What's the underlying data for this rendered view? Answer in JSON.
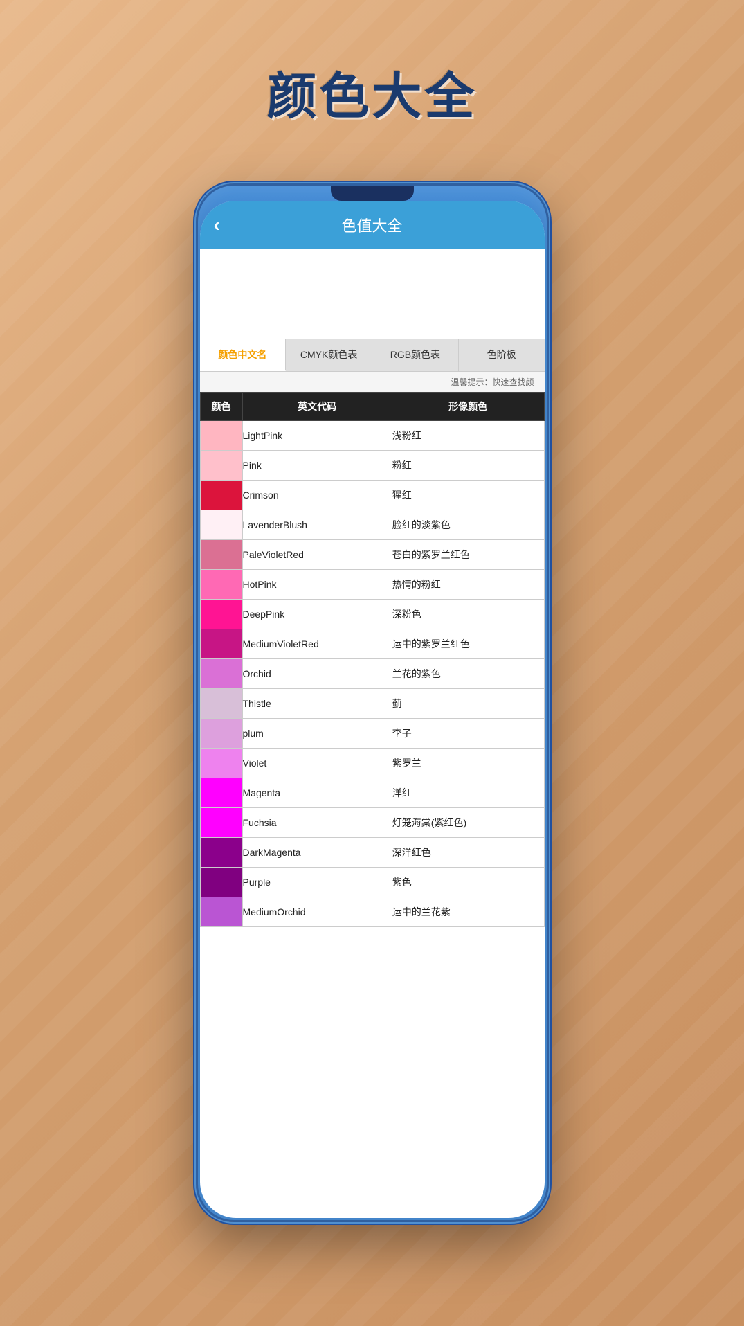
{
  "background": {
    "page_title": "颜色大全"
  },
  "header": {
    "back_label": "‹",
    "title": "色值大全"
  },
  "tabs": [
    {
      "id": "chinese-name",
      "label": "颜色中文名",
      "active": true
    },
    {
      "id": "cmyk",
      "label": "CMYK颜色表",
      "active": false
    },
    {
      "id": "rgb",
      "label": "RGB颜色表",
      "active": false
    },
    {
      "id": "gradient",
      "label": "色阶板",
      "active": false
    }
  ],
  "hint": "温馨提示：快速查找颜",
  "table": {
    "headers": [
      "颜色",
      "英文代码",
      "形像颜色"
    ],
    "rows": [
      {
        "color": "#FFB6C1",
        "name": "LightPink",
        "chinese": "浅粉红"
      },
      {
        "color": "#FFC0CB",
        "name": "Pink",
        "chinese": "粉红"
      },
      {
        "color": "#DC143C",
        "name": "Crimson",
        "chinese": "猩红"
      },
      {
        "color": "#FFF0F5",
        "name": "LavenderBlush",
        "chinese": "脸红的淡紫色"
      },
      {
        "color": "#DB7093",
        "name": "PaleVioletRed",
        "chinese": "苍白的紫罗兰红色"
      },
      {
        "color": "#FF69B4",
        "name": "HotPink",
        "chinese": "热情的粉红"
      },
      {
        "color": "#FF1493",
        "name": "DeepPink",
        "chinese": "深粉色"
      },
      {
        "color": "#C71585",
        "name": "MediumVioletRed",
        "chinese": "运中的紫罗兰红色"
      },
      {
        "color": "#DA70D6",
        "name": "Orchid",
        "chinese": "兰花的紫色"
      },
      {
        "color": "#D8BFD8",
        "name": "Thistle",
        "chinese": "蓟"
      },
      {
        "color": "#DDA0DD",
        "name": "plum",
        "chinese": "李子"
      },
      {
        "color": "#EE82EE",
        "name": "Violet",
        "chinese": "紫罗兰"
      },
      {
        "color": "#FF00FF",
        "name": "Magenta",
        "chinese": "洋红"
      },
      {
        "color": "#FF00FF",
        "name": "Fuchsia",
        "chinese": "灯笼海棠(紫红色)"
      },
      {
        "color": "#8B008B",
        "name": "DarkMagenta",
        "chinese": "深洋红色"
      },
      {
        "color": "#800080",
        "name": "Purple",
        "chinese": "紫色"
      },
      {
        "color": "#BA55D3",
        "name": "MediumOrchid",
        "chinese": "运中的兰花紫"
      }
    ]
  }
}
